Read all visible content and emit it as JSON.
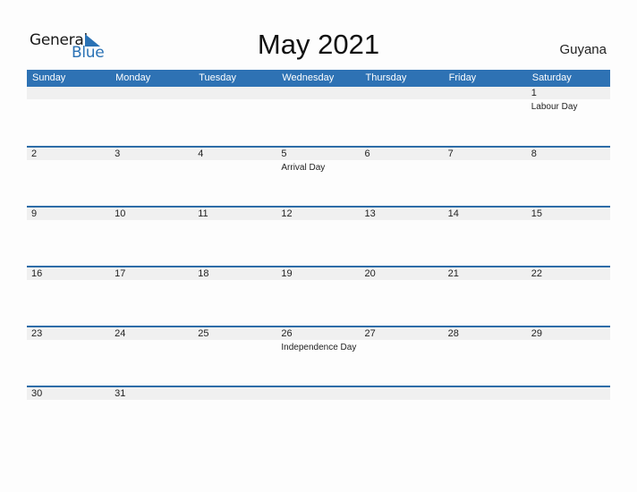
{
  "logo": {
    "line1": "General",
    "line2": "Blue"
  },
  "title": "May 2021",
  "country": "Guyana",
  "colors": {
    "header": "#2e72b4",
    "accent": "#2a72b5",
    "band": "#f0f0f0"
  },
  "weekdays": [
    "Sunday",
    "Monday",
    "Tuesday",
    "Wednesday",
    "Thursday",
    "Friday",
    "Saturday"
  ],
  "weeks": [
    [
      {
        "d": ""
      },
      {
        "d": ""
      },
      {
        "d": ""
      },
      {
        "d": ""
      },
      {
        "d": ""
      },
      {
        "d": ""
      },
      {
        "d": "1",
        "e": "Labour Day"
      }
    ],
    [
      {
        "d": "2"
      },
      {
        "d": "3"
      },
      {
        "d": "4"
      },
      {
        "d": "5",
        "e": "Arrival Day"
      },
      {
        "d": "6"
      },
      {
        "d": "7"
      },
      {
        "d": "8"
      }
    ],
    [
      {
        "d": "9"
      },
      {
        "d": "10"
      },
      {
        "d": "11"
      },
      {
        "d": "12"
      },
      {
        "d": "13"
      },
      {
        "d": "14"
      },
      {
        "d": "15"
      }
    ],
    [
      {
        "d": "16"
      },
      {
        "d": "17"
      },
      {
        "d": "18"
      },
      {
        "d": "19"
      },
      {
        "d": "20"
      },
      {
        "d": "21"
      },
      {
        "d": "22"
      }
    ],
    [
      {
        "d": "23"
      },
      {
        "d": "24"
      },
      {
        "d": "25"
      },
      {
        "d": "26",
        "e": "Independence Day"
      },
      {
        "d": "27"
      },
      {
        "d": "28"
      },
      {
        "d": "29"
      }
    ],
    [
      {
        "d": "30"
      },
      {
        "d": "31"
      },
      {
        "d": ""
      },
      {
        "d": ""
      },
      {
        "d": ""
      },
      {
        "d": ""
      },
      {
        "d": ""
      }
    ]
  ]
}
